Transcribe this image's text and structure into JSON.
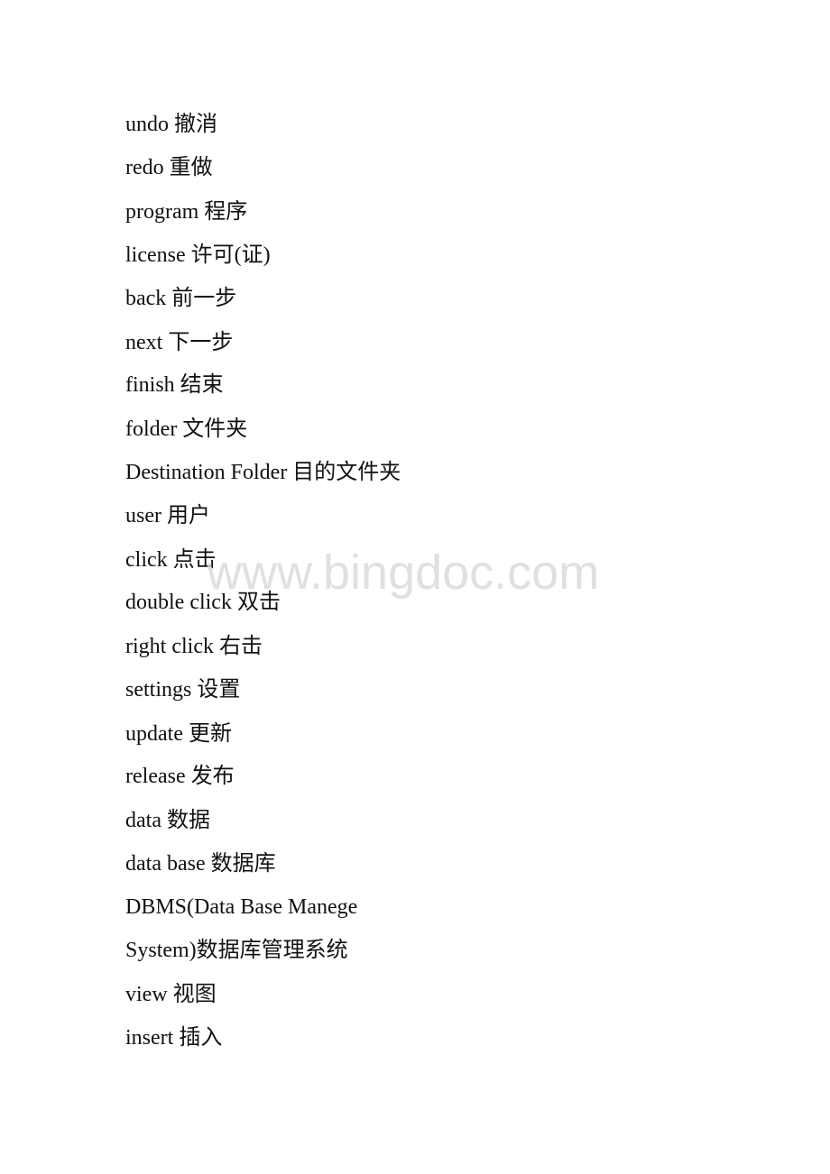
{
  "lines": [
    "undo 撤消",
    "redo 重做",
    "program 程序",
    "license 许可(证)",
    "back 前一步",
    "next 下一步",
    "finish 结束",
    "folder 文件夹",
    "Destination Folder 目的文件夹",
    "user 用户",
    "click 点击",
    "double click 双击",
    "right click 右击",
    "settings 设置",
    "update 更新",
    "release 发布",
    "data 数据",
    "data base 数据库",
    "DBMS(Data Base Manege",
    "System)数据库管理系统",
    "view 视图",
    "insert 插入"
  ],
  "watermark": "www.bingdoc.com"
}
